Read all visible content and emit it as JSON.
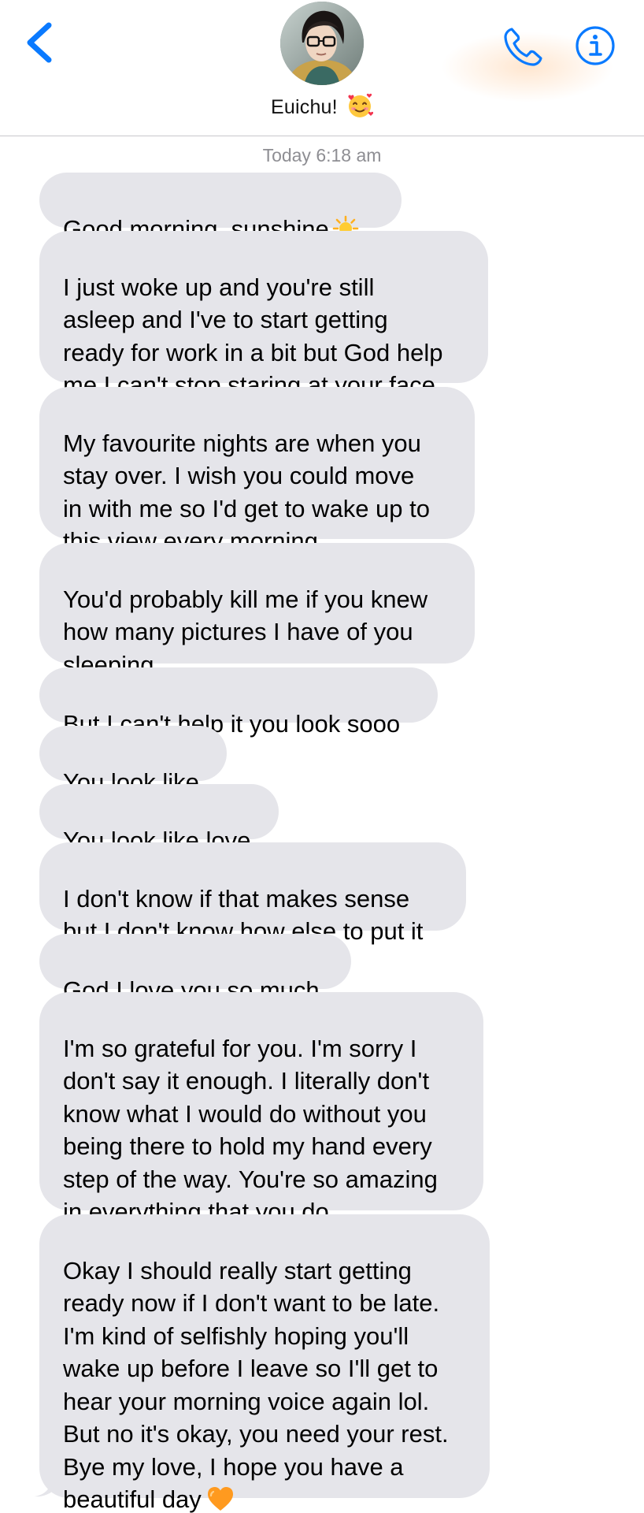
{
  "header": {
    "contact_name": "Euichu!",
    "contact_emoji": "smiling-face-with-hearts",
    "back_icon": "chevron-left-icon",
    "phone_icon": "phone-icon",
    "info_icon": "info-icon",
    "accent_color": "#0a7aff"
  },
  "thread": {
    "timestamp": "Today 6:18 am",
    "bubble_color": "#e5e5ea",
    "messages": [
      {
        "text": "Good morning, sunshine",
        "emoji": "sun-icon"
      },
      {
        "text": "I just woke up and you're still\nasleep and I've to start getting\nready for work in a bit but God help\nme I can't stop staring at your face"
      },
      {
        "text": "My favourite nights are when you\nstay over. I wish you could move\nin with me so I'd get to wake up to\nthis view every morning"
      },
      {
        "text": "You'd probably kill me if you knew\nhow many pictures I have of you\nsleeping"
      },
      {
        "text": "But I can't help it you look sooo"
      },
      {
        "text": "You look like"
      },
      {
        "text": "You look like love"
      },
      {
        "text": "I don't know if that makes sense\nbut I don't know how else to put it"
      },
      {
        "text": "God I love you so much"
      },
      {
        "text": "I'm so grateful for you. I'm sorry I\ndon't say it enough. I literally don't\nknow what I would do without you\nbeing there to hold my hand every\nstep of the way. You're so amazing\nin everything that you do"
      },
      {
        "text": "Okay I should really start getting\nready now if I don't want to be late.\nI'm kind of selfishly hoping you'll\nwake up before I leave so I'll get to\nhear your morning voice again lol.\nBut no it's okay, you need your rest.\nBye my love, I hope you have a\nbeautiful day",
        "emoji": "orange-heart-icon"
      }
    ]
  }
}
